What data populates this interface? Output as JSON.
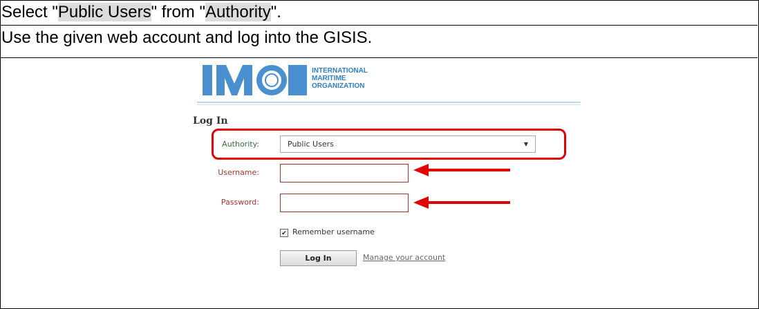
{
  "instructions": {
    "line1": {
      "prefix": "Select \"",
      "hl1": "Public Users",
      "middle": "\" from \"",
      "hl2": "Authority",
      "suffix": "\"."
    },
    "line2": "Use the given web account and log into the GISIS."
  },
  "header": {
    "logo_alt": "IMO",
    "org_line1": "INTERNATIONAL",
    "org_line2": "MARITIME",
    "org_line3": "ORGANIZATION",
    "brand_color": "#2f7fc4"
  },
  "login": {
    "title": "Log In",
    "authority_label": "Authority:",
    "authority_value": "Public Users",
    "username_label": "Username:",
    "username_value": "",
    "password_label": "Password:",
    "password_value": "",
    "remember_label": "Remember username",
    "remember_checked": true,
    "login_button": "Log In",
    "manage_link": "Manage your account"
  },
  "annotation_color": "#e30000"
}
